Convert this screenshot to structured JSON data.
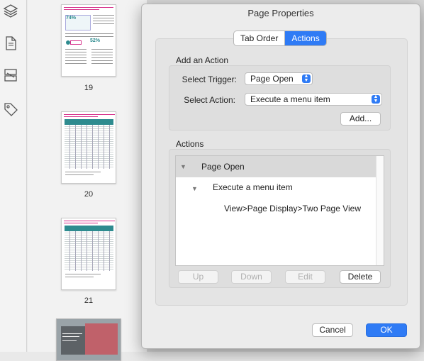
{
  "thumbnails": {
    "pages": [
      {
        "number": "19",
        "large_stat_1": "74%",
        "large_stat_2": "52%"
      },
      {
        "number": "20"
      },
      {
        "number": "21"
      }
    ]
  },
  "dialog": {
    "title": "Page Properties",
    "tabs": [
      {
        "label": "Tab Order",
        "active": false
      },
      {
        "label": "Actions",
        "active": true
      }
    ],
    "add_action": {
      "section_label": "Add an Action",
      "trigger_label": "Select Trigger:",
      "trigger_value": "Page Open",
      "action_label": "Select Action:",
      "action_value": "Execute a menu item",
      "add_button": "Add..."
    },
    "actions": {
      "section_label": "Actions",
      "tree": [
        {
          "label": "Page Open",
          "level": 0,
          "selected": true
        },
        {
          "label": "Execute a menu item",
          "level": 1,
          "selected": false
        },
        {
          "label": "View>Page Display>Two Page View",
          "level": 2,
          "selected": false
        }
      ],
      "buttons": {
        "up": "Up",
        "down": "Down",
        "edit": "Edit",
        "delete": "Delete"
      }
    },
    "footer": {
      "cancel": "Cancel",
      "ok": "OK"
    }
  },
  "colors": {
    "accent": "#2f7bf5",
    "thumb_teal": "#2e8b8f",
    "thumb_magenta": "#d62f8a"
  },
  "icons": [
    "layers-icon",
    "page-icon",
    "compare-icon",
    "tag-icon"
  ]
}
